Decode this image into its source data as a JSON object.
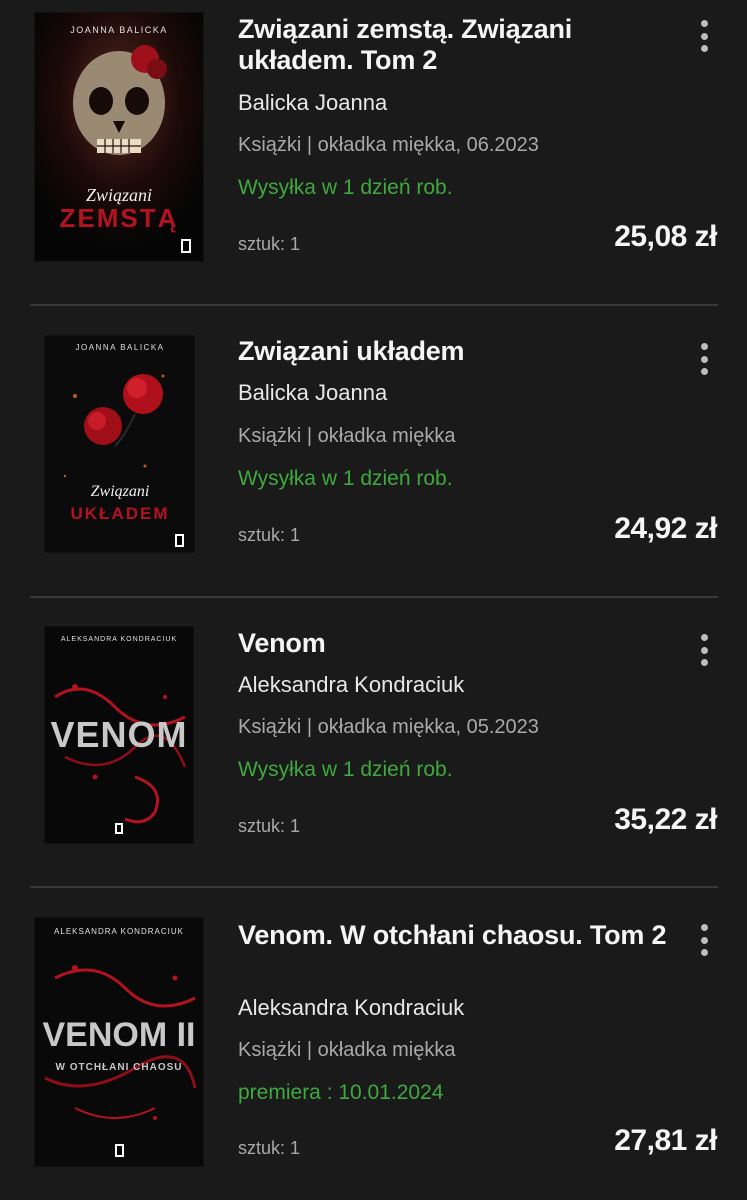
{
  "items": [
    {
      "title": "Związani zemstą. Związani układem. Tom 2",
      "author": "Balicka Joanna",
      "meta": "Książki | okładka miękka, 06.2023",
      "shipping": "Wysyłka w 1 dzień rob.",
      "quantity": "sztuk: 1",
      "price": "25,08 zł",
      "cover": {
        "author": "JOANNA BALICKA",
        "line1": "Związani",
        "line2": "ZEMSTĄ"
      }
    },
    {
      "title": "Związani układem",
      "author": "Balicka Joanna",
      "meta": "Książki | okładka miękka",
      "shipping": "Wysyłka w 1 dzień rob.",
      "quantity": "sztuk: 1",
      "price": "24,92 zł",
      "cover": {
        "author": "JOANNA BALICKA",
        "line1": "Związani",
        "line2": "UKŁADEM"
      }
    },
    {
      "title": "Venom",
      "author": "Aleksandra Kondraciuk",
      "meta": "Książki | okładka miękka, 05.2023",
      "shipping": "Wysyłka w 1 dzień rob.",
      "quantity": "sztuk: 1",
      "price": "35,22 zł",
      "cover": {
        "author": "ALEKSANDRA KONDRACIUK",
        "line1": "VENOM"
      }
    },
    {
      "title": "Venom. W otchłani chaosu. Tom 2",
      "author": "Aleksandra Kondraciuk",
      "meta": "Książki | okładka miękka",
      "shipping": "premiera : 10.01.2024",
      "quantity": "sztuk: 1",
      "price": "27,81 zł",
      "cover": {
        "author": "ALEKSANDRA KONDRACIUK",
        "line1": "VENOM II",
        "line2": "W OTCHŁANI CHAOSU"
      }
    }
  ],
  "colors": {
    "background": "#1a1a1a",
    "shipping": "#3fa83f",
    "cover_red": "#b3121f"
  }
}
